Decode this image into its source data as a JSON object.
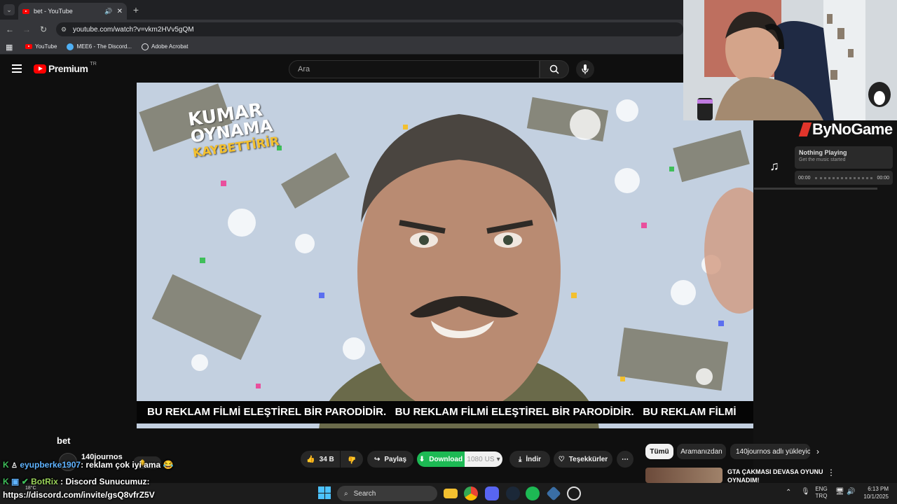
{
  "browser": {
    "tab_title": "bet - YouTube",
    "url": "youtube.com/watch?v=vkm2HVv5gQM",
    "bookmarks": [
      {
        "label": "YouTube"
      },
      {
        "label": "MEE6 - The Discord..."
      },
      {
        "label": "Adobe Acrobat"
      }
    ]
  },
  "youtube": {
    "logo_text": "Premium",
    "logo_badge": "TR",
    "search_placeholder": "Ara"
  },
  "video": {
    "overlay_lines": [
      "KUMAR",
      "OYNAMA",
      "KAYBETTİRİR"
    ],
    "subtitle": "BU REKLAM FİLMİ ELEŞTİREL BİR PARODİDİR.   BU REKLAM FİLMİ ELEŞTİREL BİR PARODİDİR.   BU REKLAM FİLMİ",
    "title": "bet",
    "channel": "140journos"
  },
  "actions": {
    "likes": "34 B",
    "share": "Paylaş",
    "download": "Download",
    "quality": "1080",
    "quality_suffix": "US",
    "indir": "İndir",
    "thanks": "Teşekkürler"
  },
  "sidebar": {
    "chips": [
      "Tümü",
      "Aramanızdan",
      "140journos adlı yükleyic"
    ],
    "rec_title_1": "GTA ÇAKMASI DEVASA OYUNU",
    "rec_title_2": "OYNADIM!"
  },
  "music_widget": {
    "brand": "ByNoGame",
    "status": "Nothing Playing",
    "hint": "Get the music started",
    "time_start": "00:00",
    "time_end": "00:00"
  },
  "chat": [
    {
      "user": "eyupberke1907",
      "message": ": reklam çok iyi ama 😂",
      "user_color": "#5fb3ff"
    },
    {
      "user": "BotRix",
      "message": ": Discord Sunucumuz:",
      "user_color": "#9bd45a"
    },
    {
      "user": "",
      "message": "https://discord.com/invite/gsQ8vfrZ5V",
      "user_color": "#ffffff"
    }
  ],
  "taskbar": {
    "search": "Search",
    "weather": "18°C",
    "lang_1": "ENG",
    "lang_2": "TRQ",
    "time": "6:13 PM",
    "date": "10/1/2025"
  },
  "colors": {
    "yt_red": "#ff0000",
    "download_green": "#1db954",
    "chip_active": "#f1f1f1"
  }
}
